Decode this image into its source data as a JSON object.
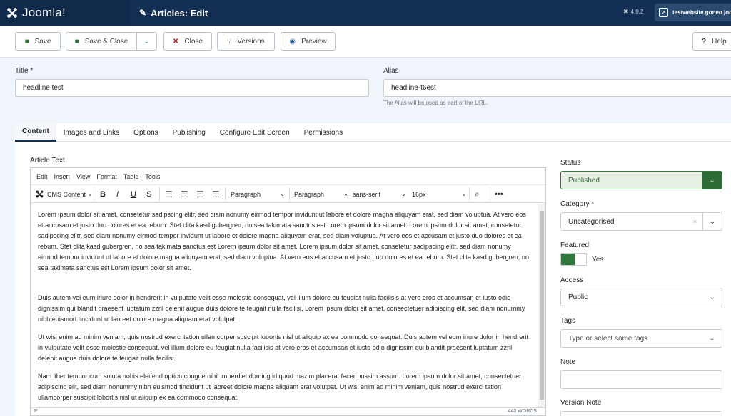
{
  "header": {
    "logo_text": "Joomla!",
    "page_title": "Articles: Edit",
    "version": "4.0.2",
    "site_link": "testwebsite goneo joomla"
  },
  "toolbar": {
    "save": "Save",
    "save_close": "Save & Close",
    "close": "Close",
    "versions": "Versions",
    "preview": "Preview",
    "help": "Help"
  },
  "form": {
    "title_label": "Title *",
    "title_value": "headline test",
    "alias_label": "Alias",
    "alias_value": "headline-t6est",
    "alias_hint": "The Alias will be used as part of the URL."
  },
  "tabs": [
    "Content",
    "Images and Links",
    "Options",
    "Publishing",
    "Configure Edit Screen",
    "Permissions"
  ],
  "editor": {
    "label": "Article Text",
    "menu": [
      "Edit",
      "Insert",
      "View",
      "Format",
      "Table",
      "Tools"
    ],
    "cms_content": "CMS Content",
    "block_format_1": "Paragraph",
    "block_format_2": "Paragraph",
    "font_family": "sans-serif",
    "font_size": "16px",
    "paragraphs": [
      "Lorem ipsum dolor sit amet, consetetur sadipscing elitr, sed diam nonumy eirmod tempor invidunt ut labore et dolore magna aliquyam erat, sed diam voluptua. At vero eos et accusam et justo duo dolores et ea rebum. Stet clita kasd gubergren, no sea takimata sanctus est Lorem ipsum dolor sit amet. Lorem ipsum dolor sit amet, consetetur sadipscing elitr, sed diam nonumy eirmod tempor invidunt ut labore et dolore magna aliquyam erat, sed diam voluptua. At vero eos et accusam et justo duo dolores et ea rebum. Stet clita kasd gubergren, no sea takimata sanctus est Lorem ipsum dolor sit amet. Lorem ipsum dolor sit amet, consetetur sadipscing elitr, sed diam nonumy eirmod tempor invidunt ut labore et dolore magna aliquyam erat, sed diam voluptua. At vero eos et accusam et justo duo dolores et ea rebum. Stet clita kasd gubergren, no sea takimata sanctus est Lorem ipsum dolor sit amet.",
      "Duis autem vel eum iriure dolor in hendrerit in vulputate velit esse molestie consequat, vel illum dolore eu feugiat nulla facilisis at vero eros et accumsan et iusto odio dignissim qui blandit praesent luptatum zzril delenit augue duis dolore te feugait nulla facilisi. Lorem ipsum dolor sit amet, consectetuer adipiscing elit, sed diam nonummy nibh euismod tincidunt ut laoreet dolore magna aliquam erat volutpat.",
      "Ut wisi enim ad minim veniam, quis nostrud exerci tation ullamcorper suscipit lobortis nisl ut aliquip ex ea commodo consequat. Duis autem vel eum iriure dolor in hendrerit in vulputate velit esse molestie consequat, vel illum dolore eu feugiat nulla facilisis at vero eros et accumsan et iusto odio dignissim qui blandit praesent luptatum zzril delenit augue duis dolore te feugait nulla facilisi.",
      "Nam liber tempor cum soluta nobis eleifend option congue nihil imperdiet doming id quod mazim placerat facer possim assum. Lorem ipsum dolor sit amet, consectetuer adipiscing elit, sed diam nonummy nibh euismod tincidunt ut laoreet dolore magna aliquam erat volutpat. Ut wisi enim ad minim veniam, quis nostrud exerci tation ullamcorper suscipit lobortis nisl ut aliquip ex ea commodo consequat."
    ],
    "path": "P",
    "word_count": "440 WORDS"
  },
  "side": {
    "status_label": "Status",
    "status_value": "Published",
    "category_label": "Category *",
    "category_value": "Uncategorised",
    "featured_label": "Featured",
    "featured_value": "Yes",
    "access_label": "Access",
    "access_value": "Public",
    "tags_label": "Tags",
    "tags_placeholder": "Type or select some tags",
    "note_label": "Note",
    "version_note_label": "Version Note"
  }
}
